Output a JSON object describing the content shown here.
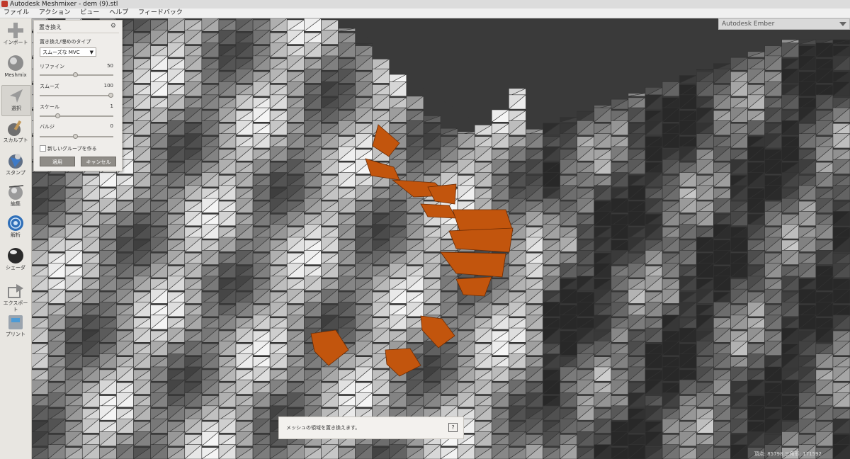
{
  "window": {
    "title": "Autodesk Meshmixer - dem (9).stl"
  },
  "menu": [
    "ファイル",
    "アクション",
    "ビュー",
    "ヘルプ",
    "フィードバック"
  ],
  "toolbar": [
    {
      "id": "import",
      "label": "インポート",
      "icon": "plus-icon"
    },
    {
      "id": "meshmix",
      "label": "Meshmix",
      "icon": "meshmix-ball-icon"
    },
    {
      "id": "select",
      "label": "選択",
      "icon": "arrow-cursor-icon",
      "active": true
    },
    {
      "id": "sculpt",
      "label": "スカルプト",
      "icon": "brush-icon"
    },
    {
      "id": "stamp",
      "label": "スタンプ",
      "icon": "stamp-icon"
    },
    {
      "id": "edit",
      "label": "編集",
      "icon": "edit-ball-icon"
    },
    {
      "id": "analysis",
      "label": "解析",
      "icon": "analysis-icon"
    },
    {
      "id": "shader",
      "label": "シェーダ",
      "icon": "shader-ball-icon"
    },
    {
      "id": "export",
      "label": "エクスポート",
      "icon": "export-icon"
    },
    {
      "id": "print",
      "label": "プリント",
      "icon": "printer-icon"
    }
  ],
  "panel": {
    "title": "置き換え",
    "type_label": "置き換え/埋めのタイプ",
    "type_value": "スムーズな MVC",
    "params": [
      {
        "label": "リファイン",
        "value": "50",
        "fraction": 0.5
      },
      {
        "label": "スムーズ",
        "value": "100",
        "fraction": 1.0
      },
      {
        "label": "スケール",
        "value": "1",
        "fraction": 0.25
      },
      {
        "label": "バルジ",
        "value": "0",
        "fraction": 0.5
      }
    ],
    "new_group_label": "新しいグループを作る",
    "apply_label": "適用",
    "cancel_label": "キャンセル"
  },
  "view_mode": {
    "value": "Autodesk Ember"
  },
  "hint": {
    "text": "メッシュの領域を置き換えます。",
    "help": "?"
  },
  "status": {
    "text": "頂点: 85798 三角形: 171592"
  },
  "colors": {
    "selection": "#c2550d",
    "background": "#3a3a3a",
    "panel": "#efedea"
  }
}
